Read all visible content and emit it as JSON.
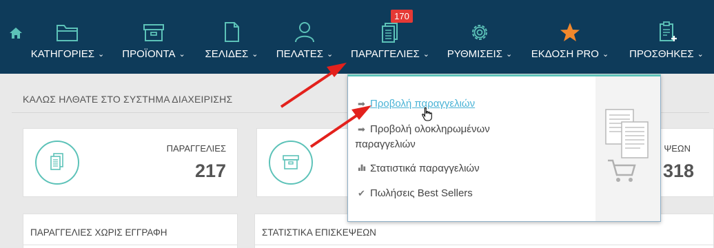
{
  "nav": {
    "badge_count": "170",
    "items": [
      {
        "label": "ΚΑΤΗΓΟΡΙΕΣ",
        "icon": "folder-icon"
      },
      {
        "label": "ΠΡΟΪΟΝΤΑ",
        "icon": "box-icon"
      },
      {
        "label": "ΣΕΛΙΔΕΣ",
        "icon": "page-icon"
      },
      {
        "label": "ΠΕΛΑΤΕΣ",
        "icon": "user-icon"
      },
      {
        "label": "ΠΑΡΑΓΓΕΛΙΕΣ",
        "icon": "orders-icon"
      },
      {
        "label": "ΡΥΘΜΙΣΕΙΣ",
        "icon": "gear-icon"
      },
      {
        "label": "ΕΚΔΟΣΗ PRO",
        "icon": "star-icon"
      },
      {
        "label": "ΠΡΟΣΘΗΚΕΣ",
        "icon": "clipboard-plus-icon"
      }
    ]
  },
  "welcome": {
    "title": "ΚΑΛΩΣ ΗΛΘΑΤΕ ΣΤΟ ΣΥΣΤΗΜΑ ΔΙΑΧΕΙΡΙΣΗΣ"
  },
  "stats": {
    "orders_label": "ΠΑΡΑΓΓΕΛΙΕΣ",
    "orders_value": "217",
    "visits_label": "ΨΕΩΝ",
    "visits_value": "318"
  },
  "panels": {
    "left_title": "ΠΑΡΑΓΓΕΛΙΕΣ ΧΩΡΙΣ ΕΓΓΡΑΦΗ",
    "right_title": "ΣΤΑΤΙΣΤΙΚΑ ΕΠΙΣΚΕΨΕΩΝ"
  },
  "dropdown": {
    "item1": "Προβολή παραγγελιών",
    "item2_line1": "Προβολή ολοκληρωμένων",
    "item2_line2": "παραγγελιών",
    "item3": "Στατιστικά παραγγελιών",
    "item4": "Πωλήσεις Best Sellers"
  },
  "colors": {
    "nav_bg": "#0e3b5a",
    "accent": "#5cc2b8",
    "badge": "#e53935",
    "link": "#4ab3d6",
    "arrow": "#e3211c"
  }
}
